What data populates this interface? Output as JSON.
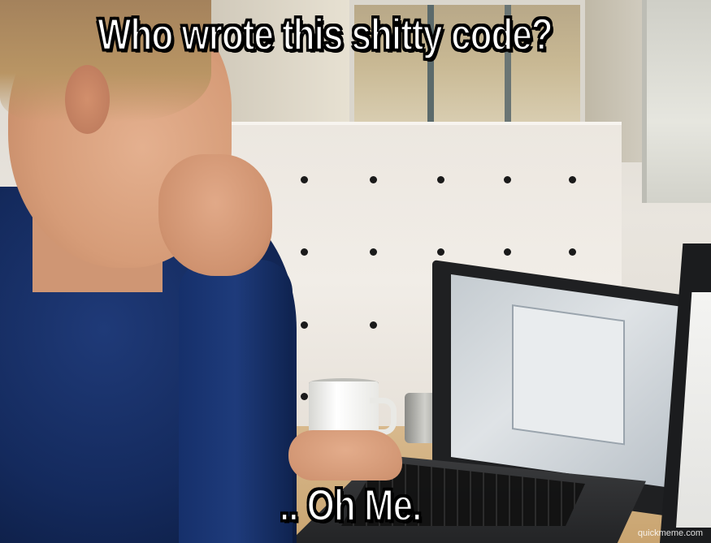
{
  "meme": {
    "top_text": "Who wrote this shitty code?",
    "bottom_text": ".. Oh Me.",
    "watermark": "quickmeme.com"
  },
  "scene": {
    "subject": "programmer-at-laptop"
  },
  "colors": {
    "sweater": "#142a5d",
    "pegboard": "#ece7e0",
    "caption_fill": "#ffffff",
    "caption_outline": "#000000"
  }
}
